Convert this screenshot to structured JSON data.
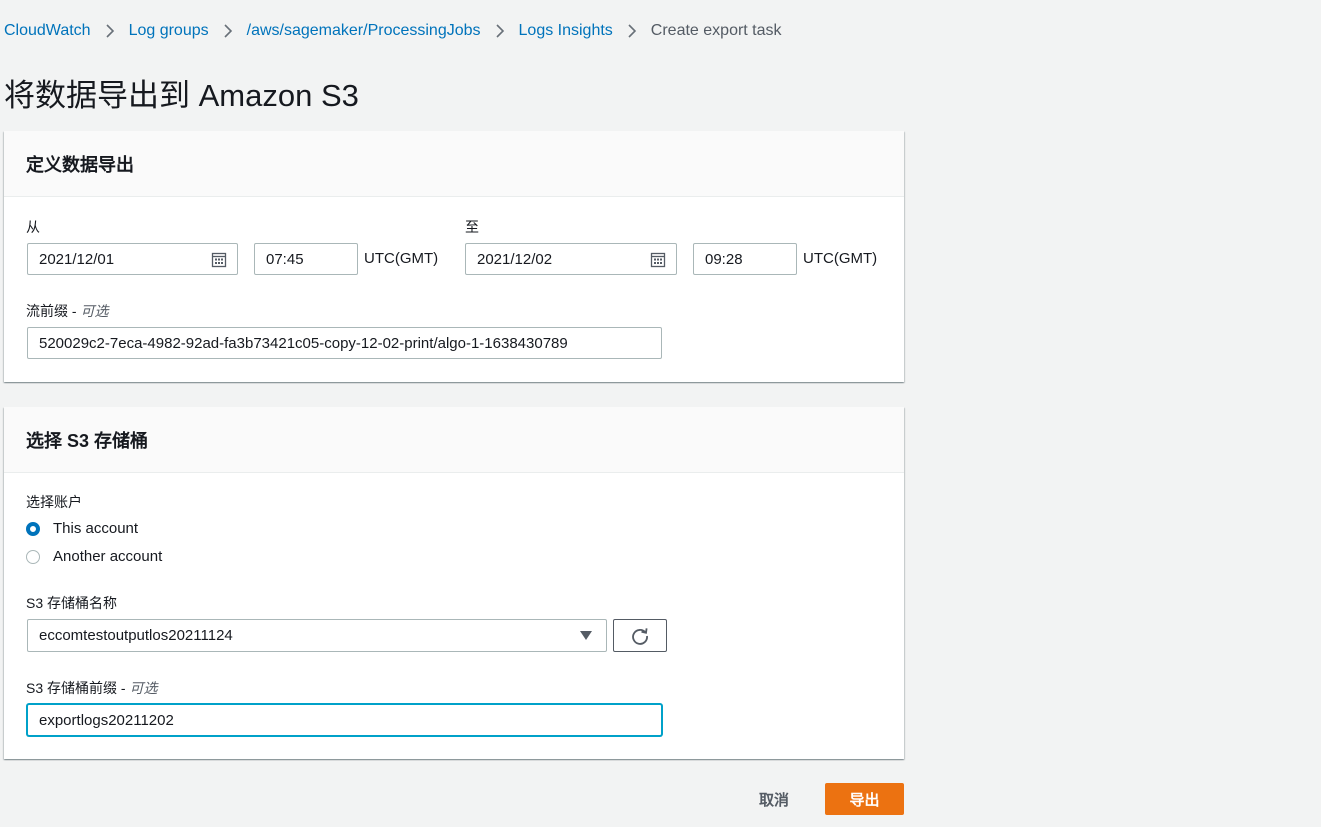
{
  "breadcrumb": {
    "items": [
      "CloudWatch",
      "Log groups",
      "/aws/sagemaker/ProcessingJobs",
      "Logs Insights"
    ],
    "current": "Create export task"
  },
  "page_title": "将数据导出到 Amazon S3",
  "define_export": {
    "header": "定义数据导出",
    "from_label": "从",
    "to_label": "至",
    "from_date": "2021/12/01",
    "from_time": "07:45",
    "to_date": "2021/12/02",
    "to_time": "09:28",
    "timezone_label": "UTC(GMT)",
    "stream_prefix_label": "流前缀 -",
    "optional_label": "可选",
    "stream_prefix_value": "520029c2-7eca-4982-92ad-fa3b73421c05-copy-12-02-print/algo-1-1638430789"
  },
  "s3_bucket": {
    "header": "选择 S3 存储桶",
    "account_label": "选择账户",
    "account_options": [
      {
        "label": "This account",
        "checked": true
      },
      {
        "label": "Another account",
        "checked": false
      }
    ],
    "bucket_name_label": "S3 存储桶名称",
    "bucket_name_value": "eccomtestoutputlos20211124",
    "bucket_prefix_label": "S3 存储桶前缀 -",
    "optional_label": "可选",
    "bucket_prefix_value": "exportlogs20211202"
  },
  "actions": {
    "cancel_label": "取消",
    "export_label": "导出"
  },
  "colors": {
    "link": "#0073bb",
    "primary_button": "#ec7211",
    "focus": "#00a1c9"
  },
  "icons": [
    "chevron-right-icon",
    "calendar-icon",
    "caret-down-icon",
    "refresh-icon"
  ]
}
